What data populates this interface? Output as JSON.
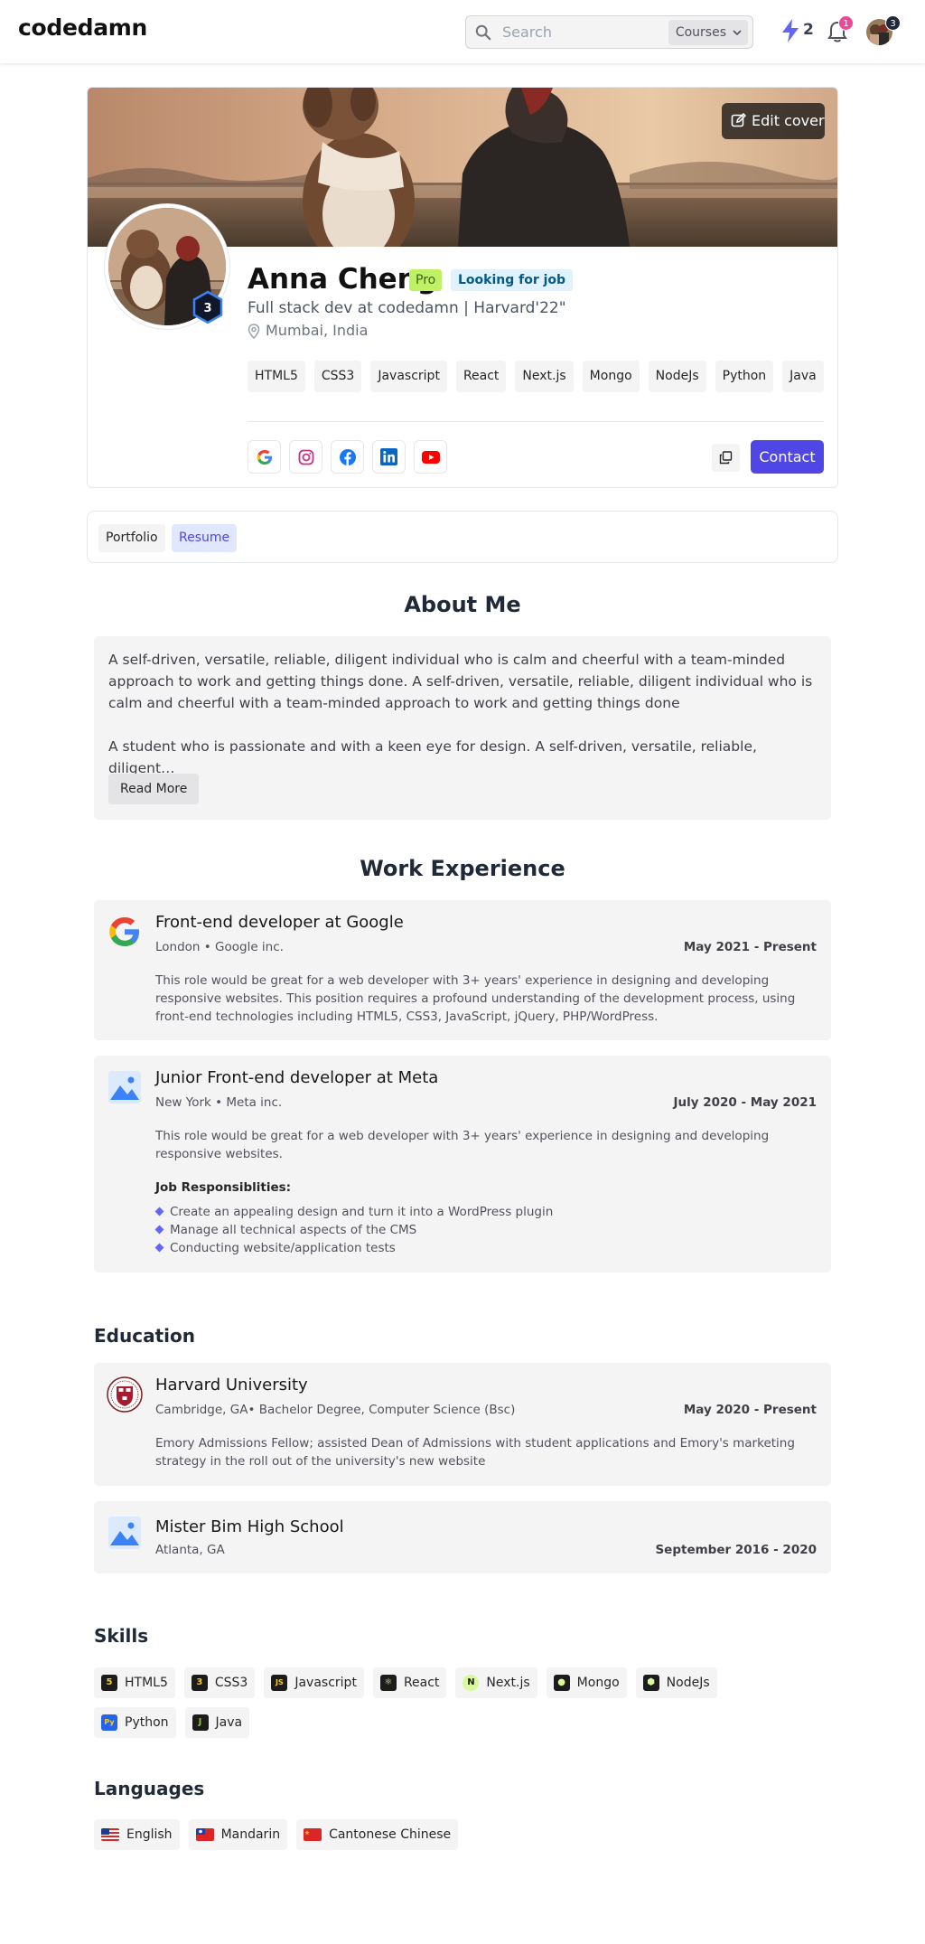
{
  "header": {
    "brand": "codedamn",
    "search_placeholder": "Search",
    "search_scope": "Courses",
    "streak_count": "2",
    "notification_count": "1",
    "avatar_badge": "3"
  },
  "profile": {
    "edit_cover_label": "Edit cover",
    "level": "3",
    "name": "Anna Cheng",
    "pro_badge": "Pro",
    "status_badge": "Looking for job",
    "headline": "Full stack dev at codedamn | Harvard'22\"",
    "location": "Mumbai, India",
    "tags": [
      "HTML5",
      "CSS3",
      "Javascript",
      "React",
      "Next.js",
      "Mongo",
      "NodeJs",
      "Python",
      "Java"
    ],
    "socials": [
      "google-icon",
      "instagram-icon",
      "facebook-icon",
      "linkedin-icon",
      "youtube-icon"
    ],
    "contact_label": "Contact"
  },
  "tabs": [
    "Portfolio",
    "Resume"
  ],
  "about": {
    "title": "About Me",
    "paragraph1": "A self-driven, versatile, reliable, diligent individual who is calm and cheerful with a team-minded approach to work and getting things done. A self-driven, versatile, reliable, diligent individual who is calm and cheerful with a team-minded approach to work and getting things done",
    "paragraph2": "A student who is passionate and with a keen eye for design. A self-driven, versatile, reliable, diligent…",
    "read_more": "Read More"
  },
  "experience": {
    "title": "Work Experience",
    "items": [
      {
        "title": "Front-end developer at Google",
        "meta": "London • Google inc.",
        "dates": "May 2021 - Present",
        "desc": "This role would be great for a web developer with 3+ years' experience in designing and developing responsive websites. This position requires a profound understanding of the development process, using front-end technologies including HTML5, CSS3, JavaScript, jQuery, PHP/WordPress."
      },
      {
        "title": "Junior Front-end developer at Meta",
        "meta": "New York • Meta inc.",
        "dates": "July 2020 - May 2021",
        "desc": "This role would be great for a web developer with 3+ years' experience in designing and developing responsive websites.",
        "resp_title": "Job Responsiblities:",
        "responsibilities": [
          "Create an appealing design and turn it into a WordPress plugin",
          "Manage all technical aspects of the CMS",
          "Conducting website/application tests"
        ]
      }
    ]
  },
  "education": {
    "title": "Education",
    "items": [
      {
        "title": "Harvard University",
        "meta": "Cambridge, GA• Bachelor Degree, Computer Science (Bsc)",
        "dates": "May 2020 - Present",
        "desc": "Emory Admissions Fellow; assisted Dean of Admissions with student applications and Emory's marketing strategy in the roll out of the university's new website"
      },
      {
        "title": "Mister Bim High School",
        "meta": "Atlanta, GA",
        "dates": "September 2016 - 2020"
      }
    ]
  },
  "skills": {
    "title": "Skills",
    "items": [
      {
        "label": "HTML5",
        "icon": "html5-icon",
        "glyph": "5",
        "color": "#facc15"
      },
      {
        "label": "CSS3",
        "icon": "css3-icon",
        "glyph": "3",
        "color": "#facc15"
      },
      {
        "label": "Javascript",
        "icon": "javascript-icon",
        "glyph": "JS",
        "color": "#facc15"
      },
      {
        "label": "React",
        "icon": "react-icon",
        "glyph": "⚛",
        "color": "#d9f99d"
      },
      {
        "label": "Next.js",
        "icon": "nextjs-icon",
        "glyph": "N",
        "color": "#d9f99d"
      },
      {
        "label": "Mongo",
        "icon": "mongo-icon",
        "glyph": "●",
        "color": "#d9f99d"
      },
      {
        "label": "NodeJs",
        "icon": "nodejs-icon",
        "glyph": "⬢",
        "color": "#d9f99d"
      },
      {
        "label": "Python",
        "icon": "python-icon",
        "glyph": "Py",
        "color": "#60a5fa"
      },
      {
        "label": "Java",
        "icon": "java-icon",
        "glyph": "J",
        "color": "#84cc16"
      }
    ]
  },
  "languages": {
    "title": "Languages",
    "items": [
      {
        "label": "English",
        "flag": "us-flag-icon"
      },
      {
        "label": "Mandarin",
        "flag": "taiwan-flag-icon"
      },
      {
        "label": "Cantonese Chinese",
        "flag": "china-flag-icon"
      }
    ]
  },
  "colors": {
    "accent": "#4f46e5",
    "pro": "#bef264",
    "job": "#e0f2fe",
    "card_bg": "#f4f4f5"
  }
}
